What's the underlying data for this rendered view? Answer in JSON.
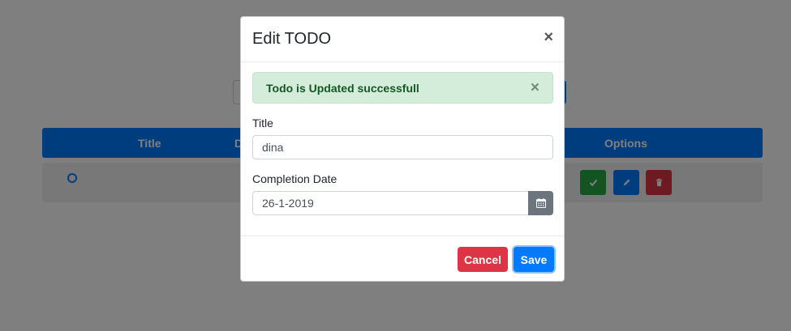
{
  "table": {
    "headers": {
      "title": "Title",
      "date": "D",
      "options": "Options"
    }
  },
  "modal": {
    "title": "Edit TODO",
    "close_glyph": "×",
    "alert": {
      "text": "Todo is Updated successfull",
      "close_glyph": "×"
    },
    "title_label": "Title",
    "title_value": "dina",
    "date_label": "Completion Date",
    "date_value": "26-1-2019",
    "cancel_label": "Cancel",
    "save_label": "Save"
  },
  "colors": {
    "primary": "#007bff",
    "success": "#28a745",
    "danger": "#dc3545",
    "secondary": "#6c757d",
    "alert_bg": "#d4edda"
  },
  "icons": [
    "circle-icon",
    "check-icon",
    "pencil-icon",
    "trash-icon",
    "calendar-icon",
    "close-icon"
  ]
}
